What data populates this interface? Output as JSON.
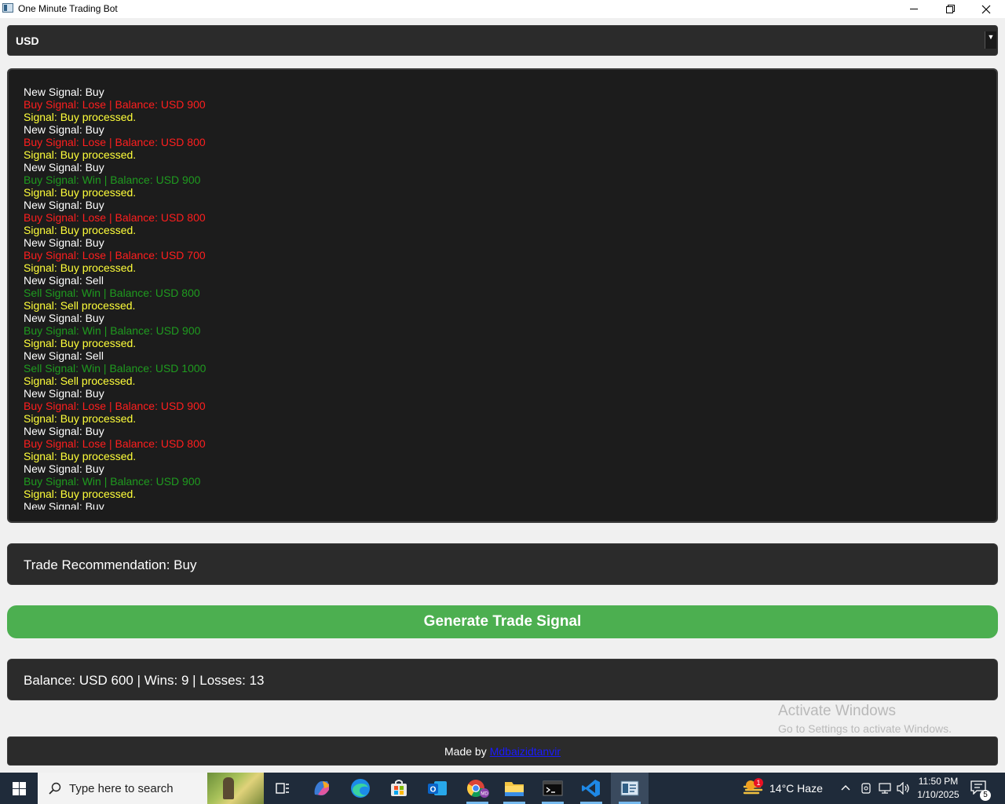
{
  "window": {
    "title": "One Minute Trading Bot"
  },
  "currency": {
    "selected": "USD"
  },
  "log": [
    {
      "text": "New Signal: Buy",
      "color": "white"
    },
    {
      "text": "Buy Signal: Lose | Balance: USD 900",
      "color": "red"
    },
    {
      "text": "Signal: Buy processed.",
      "color": "yellow"
    },
    {
      "text": "New Signal: Buy",
      "color": "white"
    },
    {
      "text": "Buy Signal: Lose | Balance: USD 800",
      "color": "red"
    },
    {
      "text": "Signal: Buy processed.",
      "color": "yellow"
    },
    {
      "text": "New Signal: Buy",
      "color": "white"
    },
    {
      "text": "Buy Signal: Win | Balance: USD 900",
      "color": "green"
    },
    {
      "text": "Signal: Buy processed.",
      "color": "yellow"
    },
    {
      "text": "New Signal: Buy",
      "color": "white"
    },
    {
      "text": "Buy Signal: Lose | Balance: USD 800",
      "color": "red"
    },
    {
      "text": "Signal: Buy processed.",
      "color": "yellow"
    },
    {
      "text": "New Signal: Buy",
      "color": "white"
    },
    {
      "text": "Buy Signal: Lose | Balance: USD 700",
      "color": "red"
    },
    {
      "text": "Signal: Buy processed.",
      "color": "yellow"
    },
    {
      "text": "New Signal: Sell",
      "color": "white"
    },
    {
      "text": "Sell Signal: Win | Balance: USD 800",
      "color": "green"
    },
    {
      "text": "Signal: Sell processed.",
      "color": "yellow"
    },
    {
      "text": "New Signal: Buy",
      "color": "white"
    },
    {
      "text": "Buy Signal: Win | Balance: USD 900",
      "color": "green"
    },
    {
      "text": "Signal: Buy processed.",
      "color": "yellow"
    },
    {
      "text": "New Signal: Sell",
      "color": "white"
    },
    {
      "text": "Sell Signal: Win | Balance: USD 1000",
      "color": "green"
    },
    {
      "text": "Signal: Sell processed.",
      "color": "yellow"
    },
    {
      "text": "New Signal: Buy",
      "color": "white"
    },
    {
      "text": "Buy Signal: Lose | Balance: USD 900",
      "color": "red"
    },
    {
      "text": "Signal: Buy processed.",
      "color": "yellow"
    },
    {
      "text": "New Signal: Buy",
      "color": "white"
    },
    {
      "text": "Buy Signal: Lose | Balance: USD 800",
      "color": "red"
    },
    {
      "text": "Signal: Buy processed.",
      "color": "yellow"
    },
    {
      "text": "New Signal: Buy",
      "color": "white"
    },
    {
      "text": "Buy Signal: Win | Balance: USD 900",
      "color": "green"
    },
    {
      "text": "Signal: Buy processed.",
      "color": "yellow"
    },
    {
      "text": "New Signal: Buy",
      "color": "white"
    }
  ],
  "recommendation": {
    "text": "Trade Recommendation: Buy"
  },
  "generate_button": {
    "label": "Generate Trade Signal"
  },
  "status": {
    "text": "Balance: USD 600 | Wins: 9 | Losses: 13"
  },
  "watermark": {
    "line1": "Activate Windows",
    "line2": "Go to Settings to activate Windows."
  },
  "footer": {
    "prefix": "Made by",
    "link_text": "Mdbaizidtanvir"
  },
  "taskbar": {
    "search_placeholder": "Type here to search",
    "weather_badge": "1",
    "weather": "14°C  Haze",
    "time": "11:50 PM",
    "date": "1/10/2025",
    "notifications": "5"
  },
  "colors": {
    "accent_green": "#4caf50",
    "log_red": "#ff1e1e",
    "log_green": "#1f9b1f",
    "log_yellow": "#ffff3a",
    "panel_bg": "#2b2b2b"
  }
}
